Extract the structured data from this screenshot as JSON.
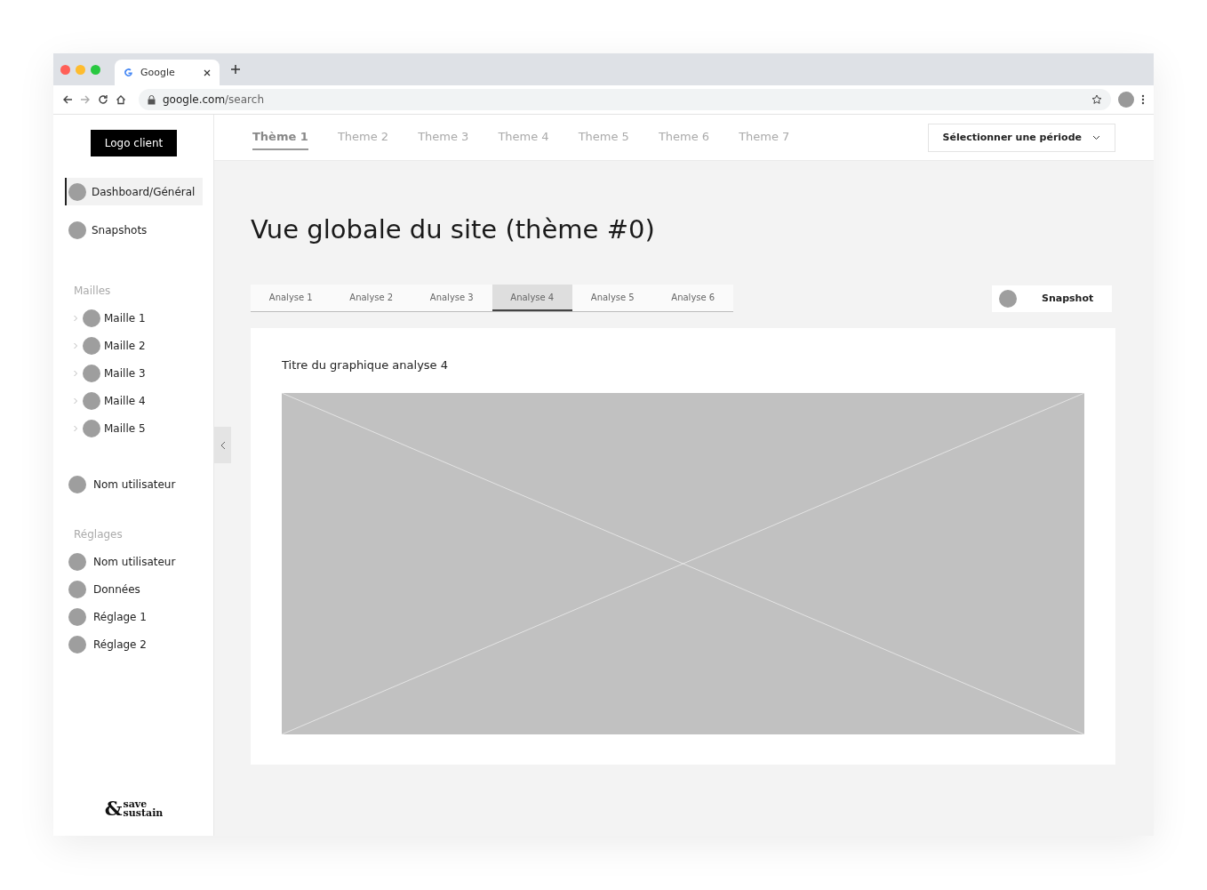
{
  "browser": {
    "tab_title": "Google",
    "url_host": "google.com",
    "url_path": "/search"
  },
  "sidebar": {
    "logo": "Logo client",
    "nav": [
      {
        "label": "Dashboard/Général",
        "selected": true
      },
      {
        "label": "Snapshots",
        "selected": false
      }
    ],
    "mailles": {
      "title": "Mailles",
      "items": [
        {
          "label": "Maille 1",
          "expanded": false
        },
        {
          "label": "Maille 2",
          "expanded": false
        },
        {
          "label": "Maille 3",
          "expanded": false
        },
        {
          "label": "Maille 4",
          "expanded": false
        },
        {
          "label": "Maille 5",
          "expanded": false
        }
      ]
    },
    "user": {
      "label": "Nom utilisateur"
    },
    "reglages": {
      "title": "Réglages",
      "items": [
        {
          "label": "Nom utilisateur"
        },
        {
          "label": "Données"
        },
        {
          "label": "Réglage 1"
        },
        {
          "label": "Réglage 2"
        }
      ]
    },
    "brand": {
      "mark": "&",
      "line1": "save",
      "line2": "sustain"
    }
  },
  "themes": [
    {
      "label": "Thème 1",
      "selected": true
    },
    {
      "label": "Theme 2",
      "selected": false
    },
    {
      "label": "Theme 3",
      "selected": false
    },
    {
      "label": "Theme 4",
      "selected": false
    },
    {
      "label": "Theme 5",
      "selected": false
    },
    {
      "label": "Theme 6",
      "selected": false
    },
    {
      "label": "Theme 7",
      "selected": false
    }
  ],
  "period_select": "Sélectionner une période",
  "page_title": "Vue globale du site (thème #0)",
  "analyses": [
    {
      "label": "Analyse 1",
      "selected": false
    },
    {
      "label": "Analyse 2",
      "selected": false
    },
    {
      "label": "Analyse 3",
      "selected": false
    },
    {
      "label": "Analyse 4",
      "selected": true
    },
    {
      "label": "Analyse 5",
      "selected": false
    },
    {
      "label": "Analyse 6",
      "selected": false
    }
  ],
  "snapshot_button": {
    "label": "Snapshot"
  },
  "card": {
    "title": "Titre du graphique analyse 4"
  }
}
